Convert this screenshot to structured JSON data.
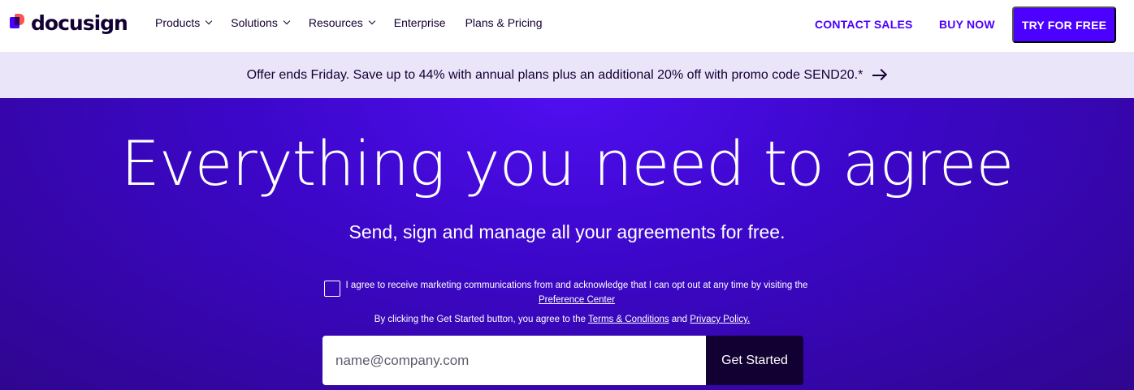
{
  "brand": {
    "name": "docusign",
    "accent": "#4c00ff",
    "dark": "#130032",
    "coral": "#ff5252"
  },
  "nav": {
    "items": [
      {
        "label": "Products",
        "has_dropdown": true
      },
      {
        "label": "Solutions",
        "has_dropdown": true
      },
      {
        "label": "Resources",
        "has_dropdown": true
      },
      {
        "label": "Enterprise",
        "has_dropdown": false
      },
      {
        "label": "Plans & Pricing",
        "has_dropdown": false
      }
    ],
    "contact_sales": "CONTACT SALES",
    "buy_now": "BUY NOW",
    "try_free": "TRY FOR FREE"
  },
  "offer": {
    "text": "Offer ends Friday. Save up to 44% with annual plans plus an additional 20% off with promo code SEND20.*",
    "icon": "arrow-right-icon"
  },
  "hero": {
    "headline": "Everything you need to agree",
    "subhead": "Send, sign and manage all your agreements for free.",
    "consent_text": "I agree to receive marketing communications from and acknowledge that I can opt out at any time by visiting the",
    "preference_center": "Preference Center",
    "terms_prefix": "By clicking the Get Started button, you agree to the",
    "terms_link": "Terms & Conditions",
    "terms_and": "and",
    "privacy_link": "Privacy Policy.",
    "email_placeholder": "name@company.com",
    "email_value": "",
    "cta": "Get Started"
  }
}
